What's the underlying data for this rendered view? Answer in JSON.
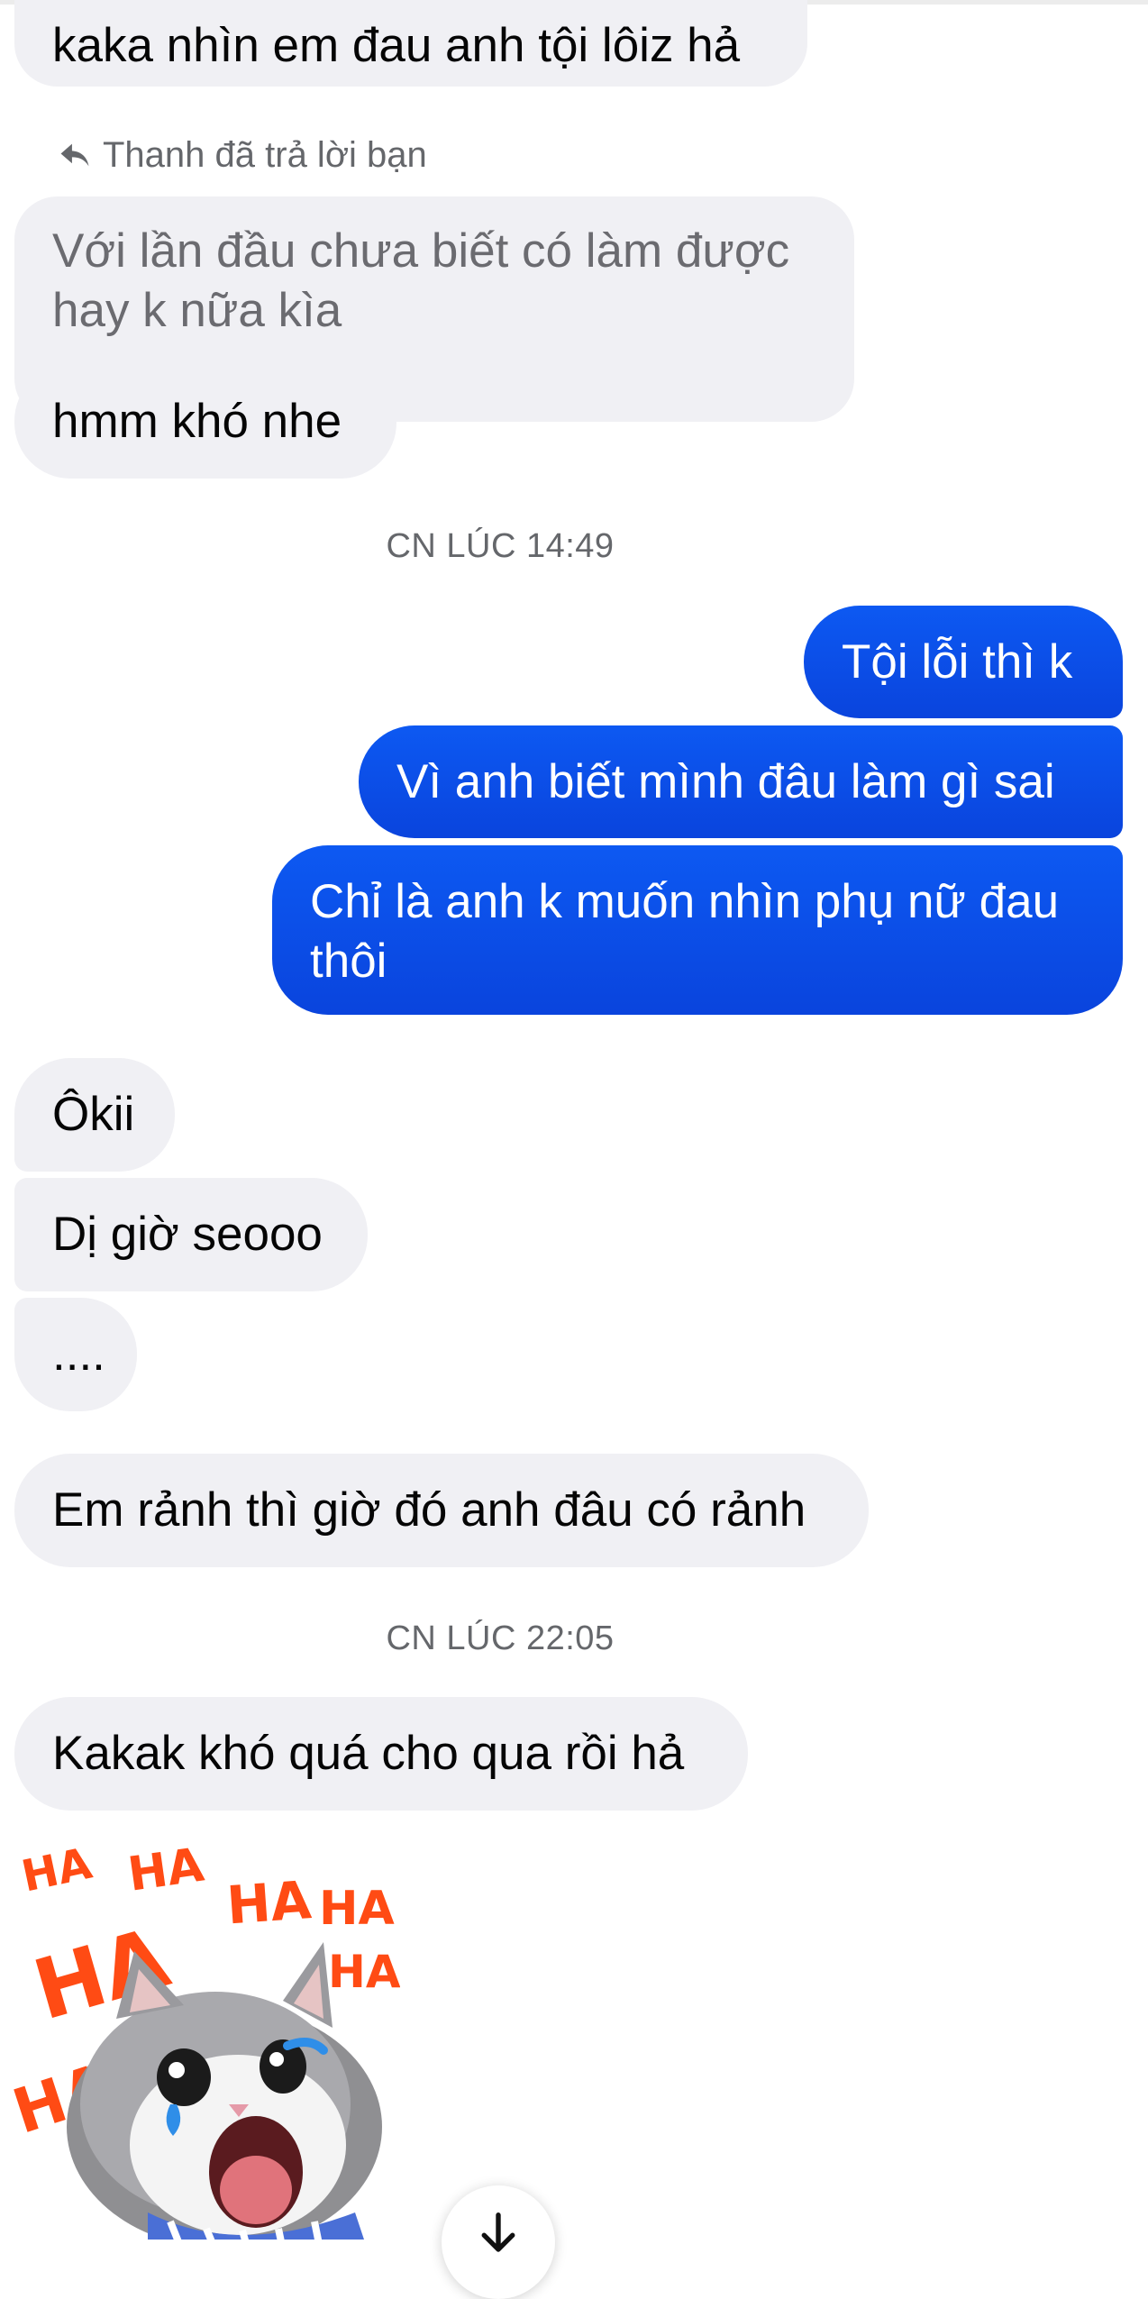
{
  "conversation": {
    "reply_label": "Thanh đã trả lời bạn",
    "messages": [
      {
        "text": "kaka nhìn em đau anh tội lôiz hả",
        "from": "them"
      },
      {
        "text": "Với lần đầu chưa biết có làm được hay k nữa kìa",
        "from": "them",
        "quoted": true
      },
      {
        "text": "hmm khó nhe",
        "from": "them"
      },
      {
        "text": "Tội lỗi thì k",
        "from": "me"
      },
      {
        "text": "Vì anh biết mình đâu làm gì sai",
        "from": "me"
      },
      {
        "text": "Chỉ là anh k muốn nhìn phụ nữ đau thôi",
        "from": "me"
      },
      {
        "text": "Ôkii",
        "from": "them"
      },
      {
        "text": "Dị giờ seooo",
        "from": "them"
      },
      {
        "text": "....",
        "from": "them"
      },
      {
        "text": "Em rảnh thì giờ đó anh đâu có rảnh",
        "from": "them"
      },
      {
        "text": "Kakak khó quá cho qua rồi hả",
        "from": "them"
      }
    ],
    "timestamps": [
      "CN LÚC 14:49",
      "CN LÚC 22:05"
    ],
    "sticker": {
      "icon": "laughing-cat-sticker",
      "words": [
        "HA",
        "HA",
        "HA",
        "HA",
        "HA",
        "HA",
        "HA"
      ]
    }
  },
  "controls": {
    "scroll_down_icon": "arrow-down-icon"
  },
  "colors": {
    "incoming_bubble": "#f0f0f4",
    "outgoing_bubble": "#0a4ee6",
    "timestamp": "#65676b"
  }
}
